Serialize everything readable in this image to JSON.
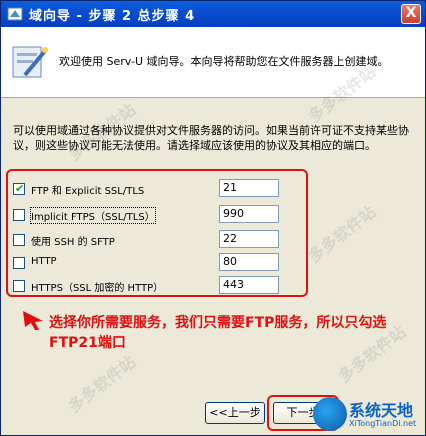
{
  "window": {
    "title": "域向导 - 步骤 2 总步骤 4",
    "close_label": "X"
  },
  "header": {
    "text": "欢迎使用 Serv-U 域向导。本向导将帮助您在文件服务器上创建域。"
  },
  "description": "可以使用域通过各种协议提供对文件服务器的访问。如果当前许可证不支持某些协议，则这些协议可能无法使用。请选择域应该使用的协议及其相应的端口。",
  "protocols": [
    {
      "label": "FTP 和 Explicit SSL/TLS",
      "port": "21",
      "checked": true
    },
    {
      "label": "Implicit FTPS（SSL/TLS）",
      "port": "990",
      "checked": false
    },
    {
      "label": "使用 SSH 的 SFTP",
      "port": "22",
      "checked": false
    },
    {
      "label": "HTTP",
      "port": "80",
      "checked": false
    },
    {
      "label": "HTTPS（SSL 加密的 HTTP）",
      "port": "443",
      "checked": false
    }
  ],
  "annotation": "选择你所需要服务，我们只需要FTP服务，所以只勾选FTP21端口",
  "buttons": {
    "back_label": "<<上一步",
    "next_label": "下一步"
  },
  "watermarks": {
    "text": "多多软件站"
  },
  "logo": {
    "name": "系统天地",
    "url": "XiTongTianDi.net"
  },
  "colors": {
    "title_bar": "#0a4fd0",
    "annotation_red": "#e01010",
    "window_bg": "#ece9d8",
    "check_green": "#21a121",
    "logo_blue": "#0a64c8"
  }
}
